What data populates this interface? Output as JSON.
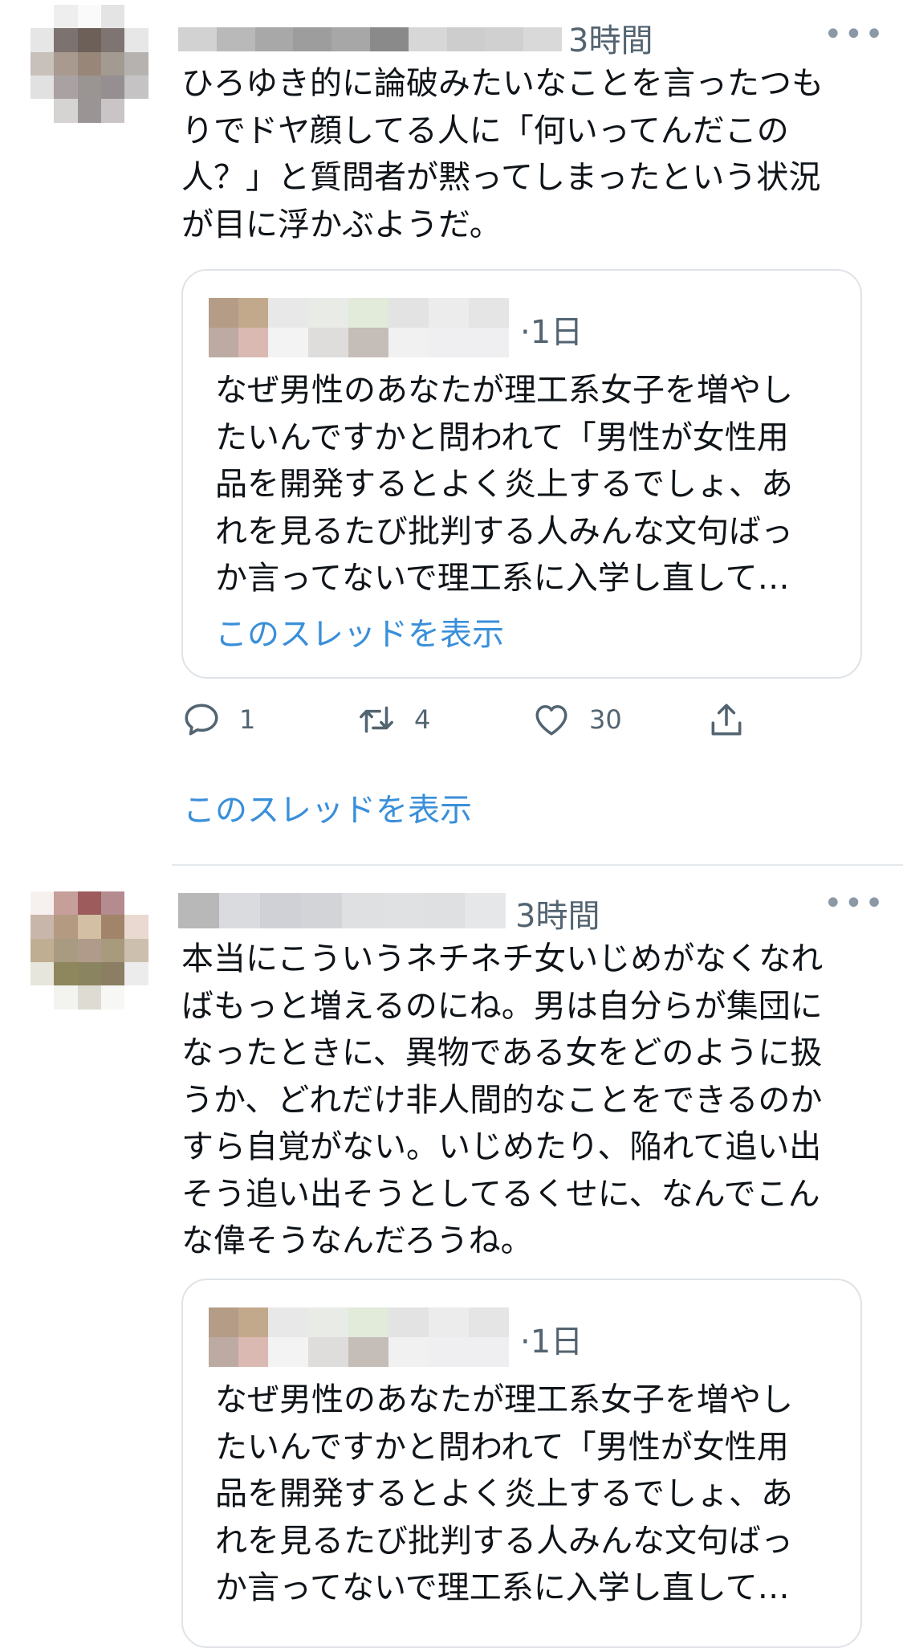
{
  "tweets": [
    {
      "time": "3時間",
      "more": "•••",
      "text": "ひろゆき的に論破みたいなことを言ったつも\nりでドヤ顔してる人に「何いってんだこの\n人？」と質問者が黙ってしまったという状況\nが目に浮かぶようだ。",
      "quote": {
        "time": "·1日",
        "text": "なぜ男性のあなたが理工系女子を増やし\nたいんですかと問われて「男性が女性用\n品を開発するとよく炎上するでしょ、あ\nれを見るたび批判する人みんな文句ばっ\nか言ってないで理工系に入学し直して…",
        "show_thread": "このスレッドを表示"
      },
      "actions": {
        "replies": "1",
        "retweets": "4",
        "likes": "30"
      },
      "show_thread": "このスレッドを表示"
    },
    {
      "time": "3時間",
      "more": "•••",
      "text": "本当にこういうネチネチ女いじめがなくなれ\nばもっと増えるのにね。男は自分らが集団に\nなったときに、異物である女をどのように扱\nうか、どれだけ非人間的なことをできるのか\nすら自覚がない。いじめたり、陥れて追い出\nそう追い出そうとしてるくせに、なんでこん\nな偉そうなんだろうね。",
      "quote": {
        "time": "·1日",
        "text": "なぜ男性のあなたが理工系女子を増やし\nたいんですかと問われて「男性が女性用\n品を開発するとよく炎上するでしょ、あ\nれを見るたび批判する人みんな文句ばっ\nか言ってないで理工系に入学し直して…"
      }
    }
  ],
  "colors": {
    "link": "#3a8fd9",
    "secondary_text": "#536471",
    "border": "#dfe3e7"
  },
  "icons": [
    "reply-icon",
    "retweet-icon",
    "like-icon",
    "share-icon",
    "more-icon"
  ]
}
